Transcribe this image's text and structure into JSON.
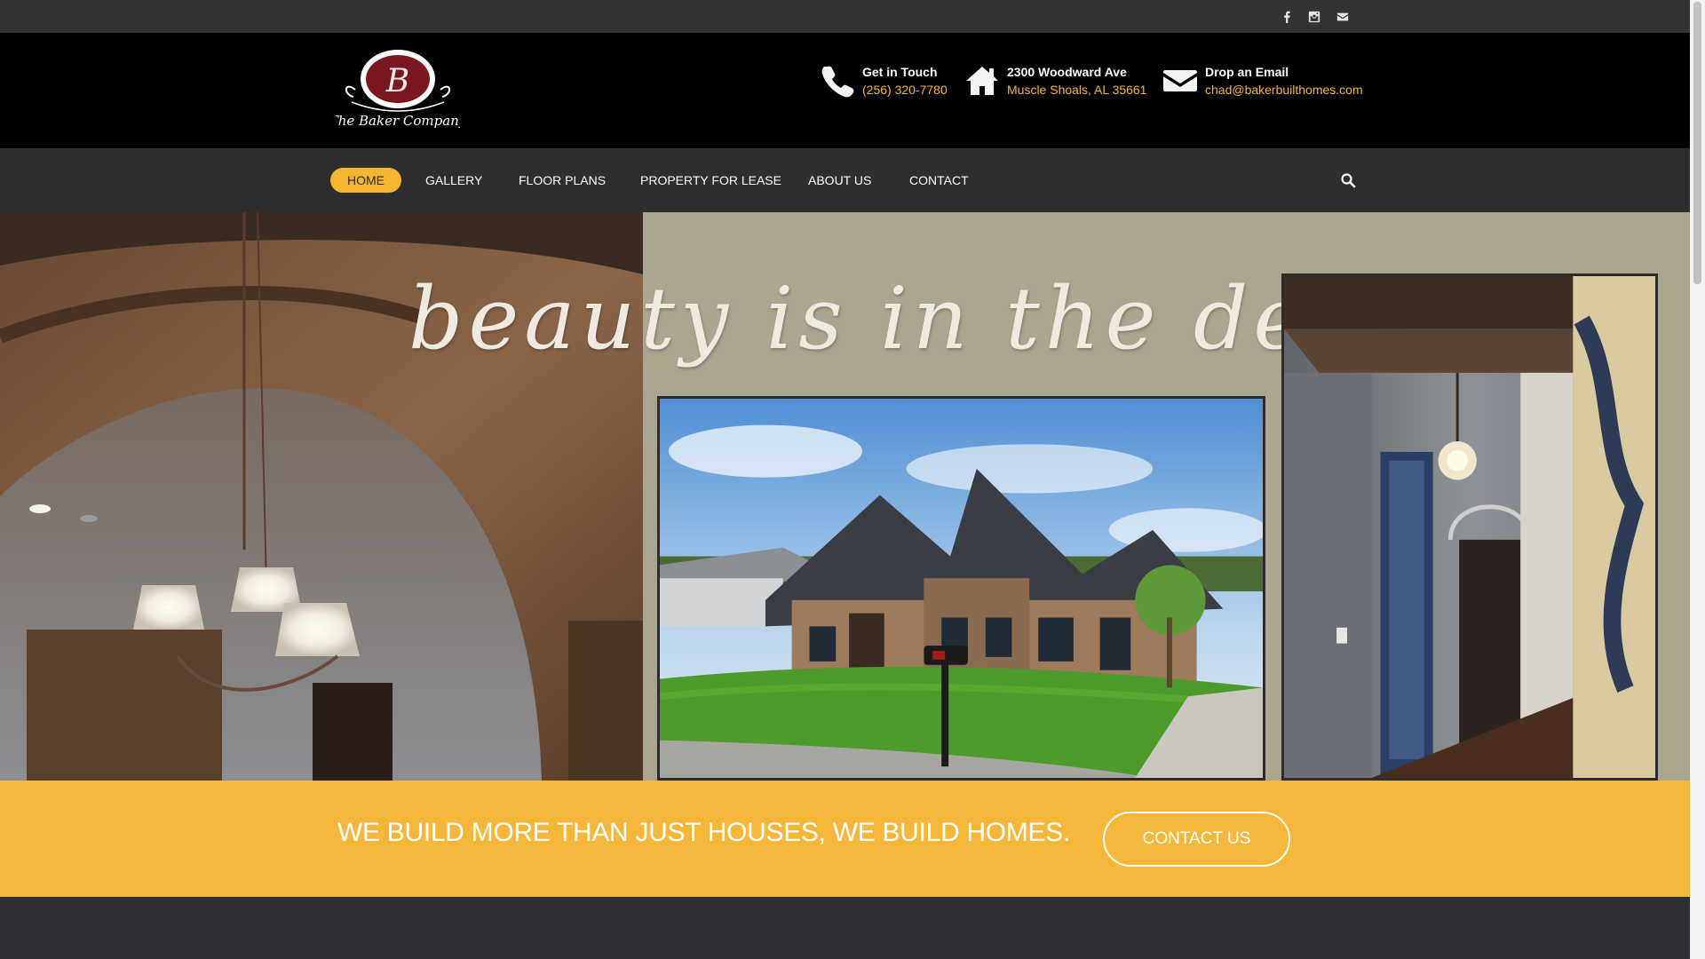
{
  "topbar": {
    "social": [
      {
        "name": "facebook-icon"
      },
      {
        "name": "instagram-icon"
      },
      {
        "name": "email-icon"
      }
    ]
  },
  "header": {
    "logo": {
      "letter": "B",
      "name": "The Baker Company"
    },
    "contact": [
      {
        "icon": "phone-icon",
        "title": "Get in Touch",
        "value": "(256) 320-7780"
      },
      {
        "icon": "home-icon",
        "title": "2300 Woodward Ave",
        "value": "Muscle Shoals, AL 35661"
      },
      {
        "icon": "envelope-icon",
        "title": "Drop an Email",
        "value": "chad@bakerbuilthomes.com"
      }
    ]
  },
  "nav": {
    "items": [
      {
        "label": "HOME",
        "active": true
      },
      {
        "label": "GALLERY"
      },
      {
        "label": "FLOOR PLANS"
      },
      {
        "label": "PROPERTY FOR LEASE"
      },
      {
        "label": "ABOUT US"
      },
      {
        "label": "CONTACT"
      }
    ],
    "search_icon": "search-icon"
  },
  "hero": {
    "tagline": "beauty is in the details"
  },
  "band": {
    "text": "WE BUILD MORE THAN JUST HOUSES, WE BUILD HOMES.",
    "cta": "CONTACT US"
  },
  "colors": {
    "accent": "#f5b62f",
    "header_bg": "#000000",
    "nav_bg": "#2e2e2e",
    "topbar_bg": "#333333"
  }
}
